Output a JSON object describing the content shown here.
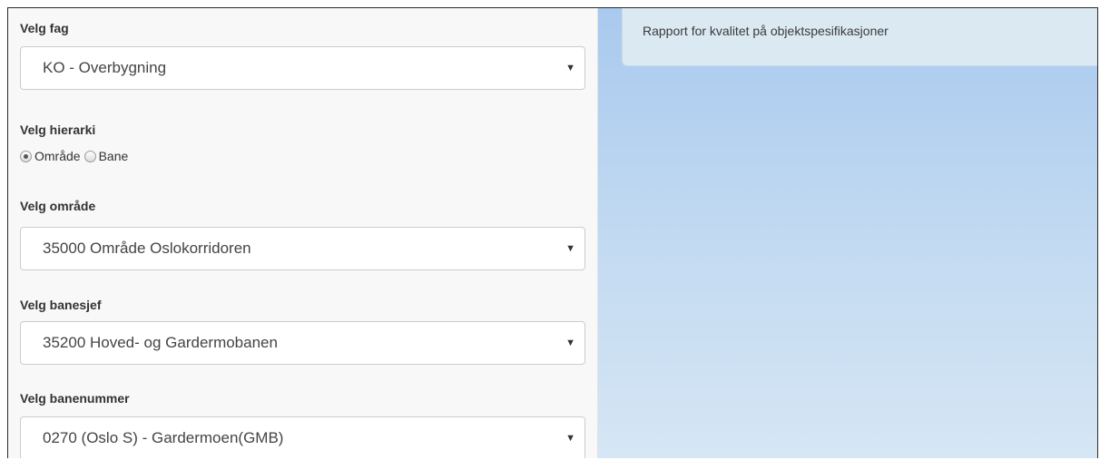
{
  "form": {
    "fag": {
      "label": "Velg fag",
      "value": "KO - Overbygning"
    },
    "hierarki": {
      "label": "Velg hierarki",
      "options": [
        {
          "label": "Område",
          "checked": true
        },
        {
          "label": "Bane",
          "checked": false
        }
      ]
    },
    "omrade": {
      "label": "Velg område",
      "value": "35000 Område Oslokorridoren"
    },
    "banesjef": {
      "label": "Velg banesjef",
      "value": "35200 Hoved- og Gardermobanen"
    },
    "banenummer": {
      "label": "Velg banenummer",
      "value": "0270 (Oslo S) - Gardermoen(GMB)"
    }
  },
  "content": {
    "panel_title": "Rapport for kvalitet på objektspesifikasjoner"
  },
  "icons": {
    "dropdown": "caret-down-icon"
  },
  "colors": {
    "sidebar_bg": "#f8f8f8",
    "panel_bg": "#dbe9f3",
    "content_gradient_top": "#a9c9ee"
  }
}
